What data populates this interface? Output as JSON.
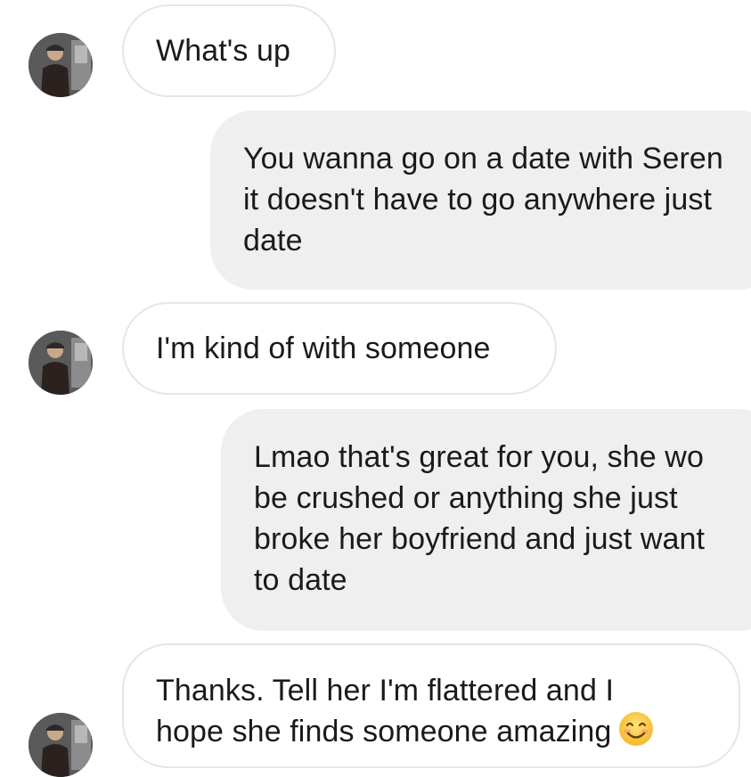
{
  "conversation": {
    "messages": [
      {
        "direction": "incoming",
        "lines": [
          "What's up"
        ]
      },
      {
        "direction": "outgoing",
        "lines": [
          "You wanna go on a date with Seren",
          "it doesn't have to go anywhere just",
          "date"
        ]
      },
      {
        "direction": "incoming",
        "lines": [
          "I'm kind of with someone"
        ]
      },
      {
        "direction": "outgoing",
        "lines": [
          "Lmao that's great for you, she wo",
          "be crushed or anything she just",
          "broke her boyfriend and just want",
          "to date"
        ]
      },
      {
        "direction": "incoming",
        "lines": [
          "Thanks. Tell her I'm flattered and I",
          "hope she finds someone amazing"
        ],
        "emoji": "smiling-face-emoji"
      }
    ]
  },
  "colors": {
    "incoming_bubble_bg": "#ffffff",
    "incoming_bubble_border": "#e6e6e6",
    "outgoing_bubble_bg": "#efefef",
    "text": "#1a1a1a"
  }
}
